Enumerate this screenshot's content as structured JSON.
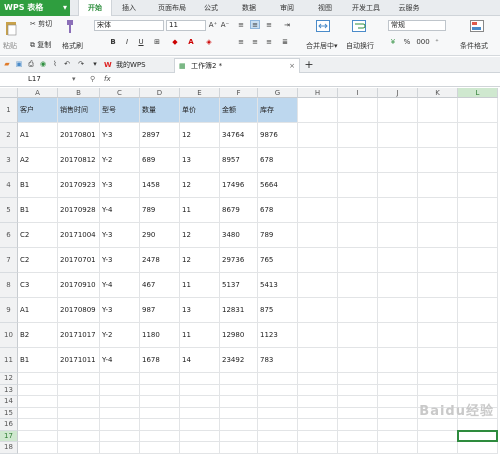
{
  "app": {
    "name": "WPS 表格"
  },
  "menu_tabs": [
    "开始",
    "插入",
    "页面布局",
    "公式",
    "数据",
    "审阅",
    "视图",
    "开发工具",
    "云服务"
  ],
  "ribbon": {
    "cut": "剪切",
    "copy": "复制",
    "paste": "粘贴",
    "format_painter": "格式刷",
    "font_name": "宋体",
    "font_size": "11",
    "bold": "B",
    "italic": "I",
    "underline": "U",
    "merge_center": "合并居中",
    "wrap_text": "自动换行",
    "number_format": "常规",
    "percent": "%",
    "comma": "000",
    "conditional_format": "条件格式"
  },
  "doc_tabs": [
    {
      "label": "我的WPS"
    },
    {
      "label": "工作簿2 *"
    }
  ],
  "formula_bar": {
    "cell_ref": "L17",
    "fx": "fx",
    "value": ""
  },
  "columns": [
    "A",
    "B",
    "C",
    "D",
    "E",
    "F",
    "G",
    "H",
    "I",
    "J",
    "K",
    "L"
  ],
  "rows": [
    "1",
    "2",
    "3",
    "4",
    "5",
    "6",
    "7",
    "8",
    "9",
    "10",
    "11",
    "12",
    "13",
    "14",
    "15",
    "16",
    "17",
    "18"
  ],
  "table": {
    "headers": [
      "客户",
      "销售时间",
      "型号",
      "数量",
      "单价",
      "金额",
      "库存"
    ],
    "rows": [
      [
        "A1",
        "20170801",
        "Y-3",
        "2897",
        "12",
        "34764",
        "9876"
      ],
      [
        "A2",
        "20170812",
        "Y-2",
        "689",
        "13",
        "8957",
        "678"
      ],
      [
        "B1",
        "20170923",
        "Y-3",
        "1458",
        "12",
        "17496",
        "5664"
      ],
      [
        "B1",
        "20170928",
        "Y-4",
        "789",
        "11",
        "8679",
        "678"
      ],
      [
        "C2",
        "20171004",
        "Y-3",
        "290",
        "12",
        "3480",
        "789"
      ],
      [
        "C2",
        "20170701",
        "Y-3",
        "2478",
        "12",
        "29736",
        "765"
      ],
      [
        "C3",
        "20170910",
        "Y-4",
        "467",
        "11",
        "5137",
        "5413"
      ],
      [
        "A1",
        "20170809",
        "Y-3",
        "987",
        "13",
        "12831",
        "875"
      ],
      [
        "B2",
        "20171017",
        "Y-2",
        "1180",
        "11",
        "12980",
        "1123"
      ],
      [
        "B1",
        "20171011",
        "Y-4",
        "1678",
        "14",
        "23492",
        "783"
      ]
    ]
  },
  "watermark": "Baidu经验",
  "colors": {
    "header_fill": "#bdd7ee",
    "brand_green": "#2f9e3f",
    "selection": "#2e8b3e"
  }
}
